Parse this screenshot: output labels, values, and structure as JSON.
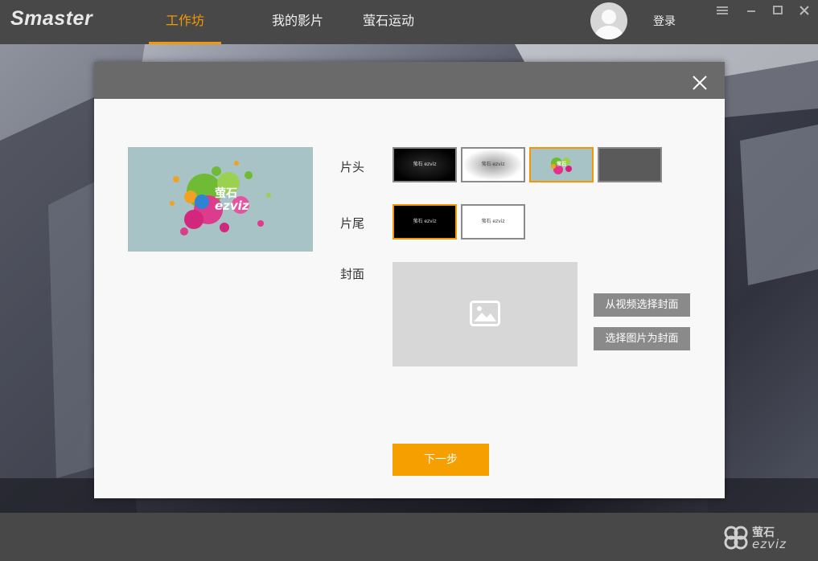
{
  "app": {
    "logo_text": "Smaster",
    "nav_tabs": [
      {
        "label": "工作坊",
        "active": true
      },
      {
        "label": "我的影片",
        "active": false
      },
      {
        "label": "萤石运动",
        "active": false
      }
    ],
    "login_label": "登录",
    "accent_color": "#f39800"
  },
  "dialog": {
    "labels": {
      "intro": "片头",
      "outro": "片尾",
      "cover": "封面"
    },
    "preview_brand": {
      "cn": "萤石",
      "en": "ezviz"
    },
    "intro_thumbs": [
      {
        "style": "black",
        "selected": false,
        "mark": "萤石 ezviz"
      },
      {
        "style": "white",
        "selected": false,
        "mark": "萤石 ezviz"
      },
      {
        "style": "splash",
        "selected": true,
        "mark": "萤石"
      },
      {
        "style": "blank",
        "selected": false,
        "mark": ""
      }
    ],
    "outro_thumbs": [
      {
        "style": "black",
        "selected": true,
        "mark": "萤石 ezviz"
      },
      {
        "style": "white",
        "selected": false,
        "mark": "萤石 ezviz"
      }
    ],
    "cover_from_video_label": "从视频选择封面",
    "cover_from_image_label": "选择图片为封面",
    "next_label": "下一步"
  },
  "footer": {
    "brand_cn": "萤石",
    "brand_en": "ezviz"
  }
}
